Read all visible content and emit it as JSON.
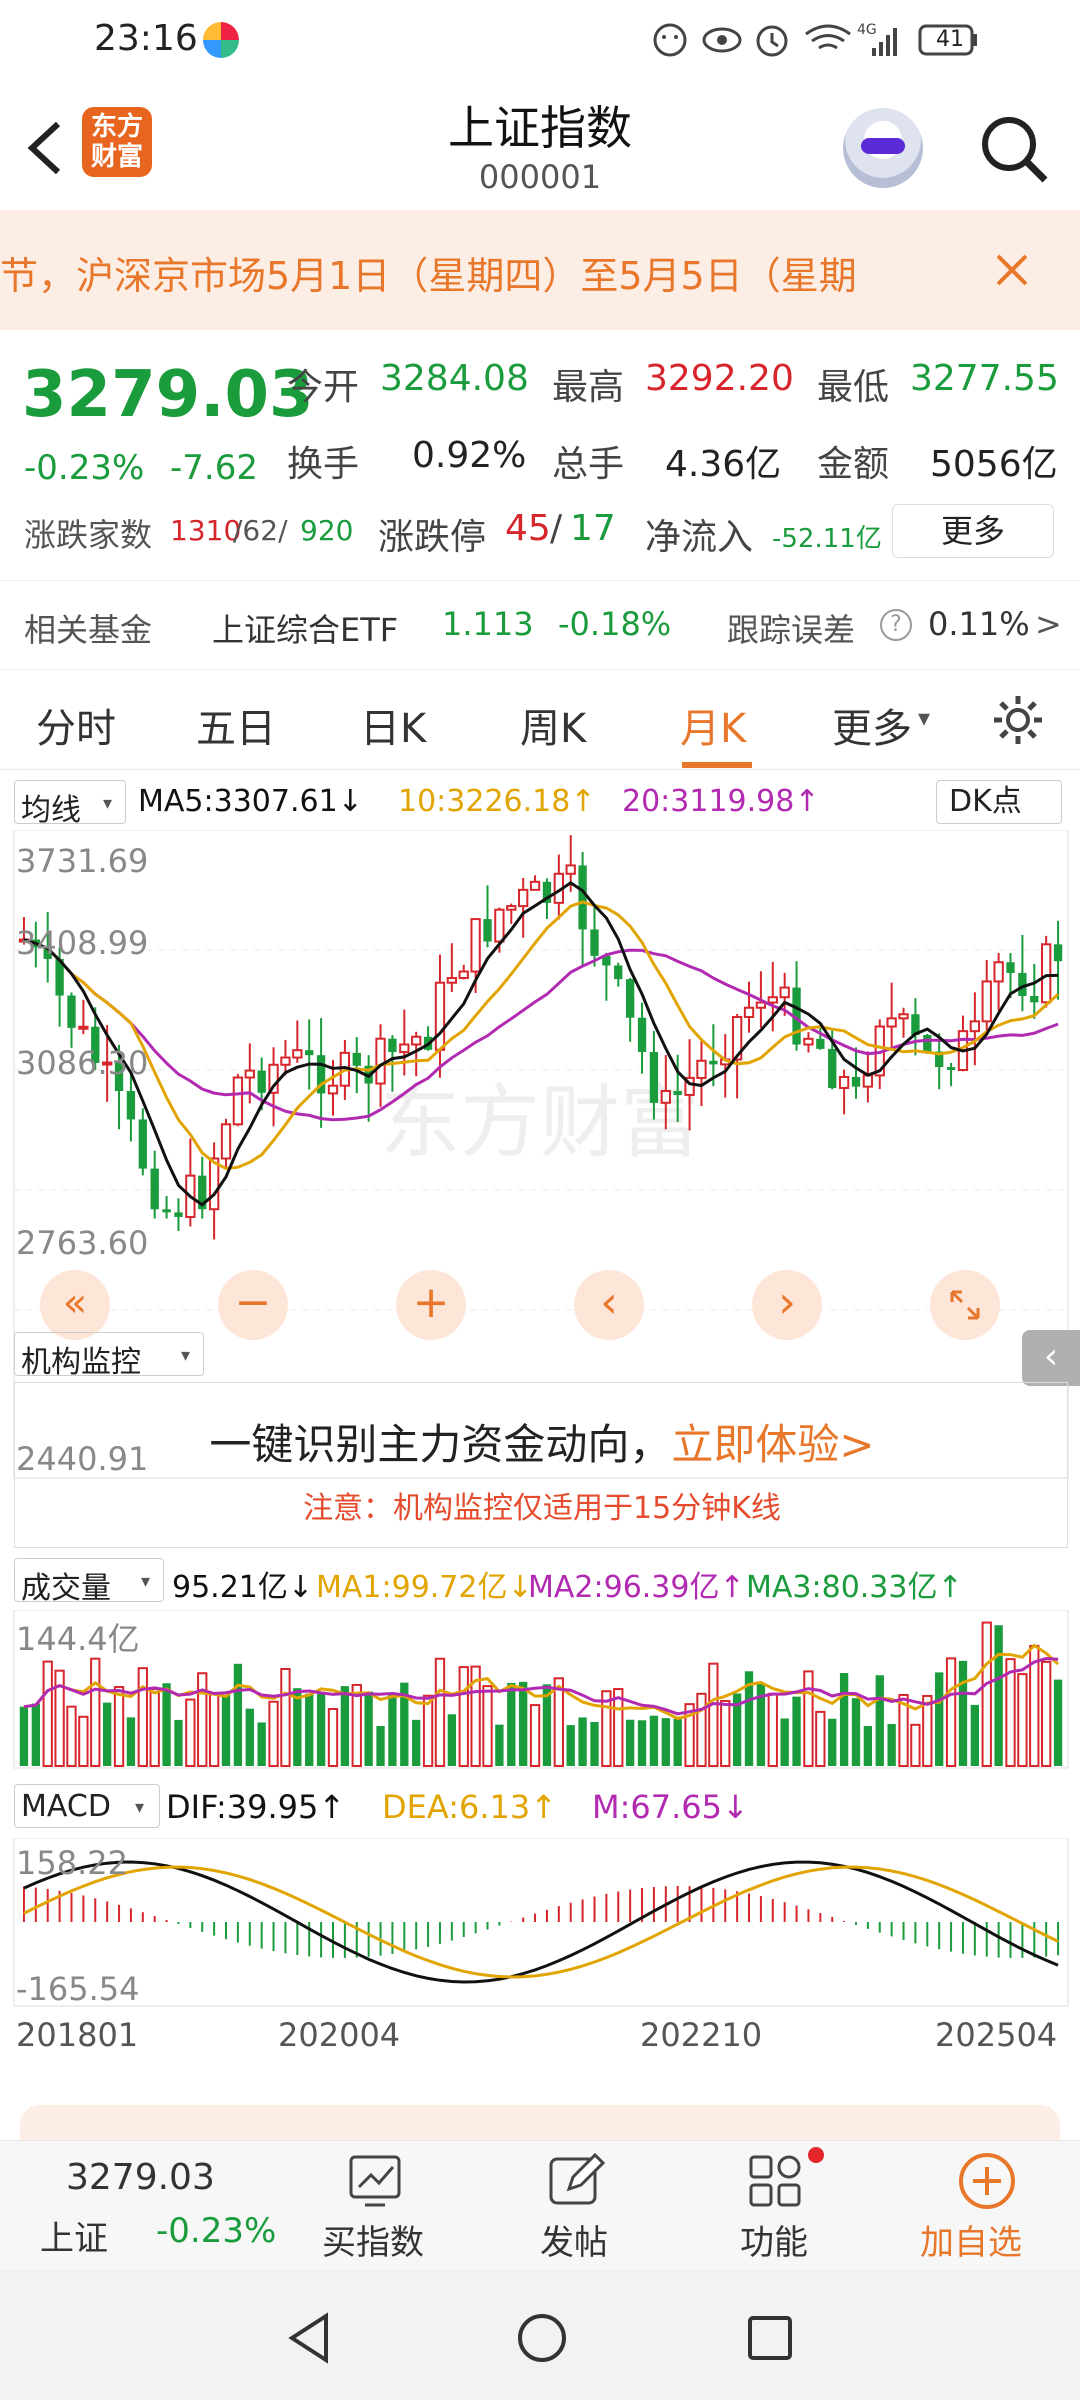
{
  "status_bar": {
    "time": "23:16",
    "network": "4G",
    "battery": "41",
    "icons": [
      "app-logo-icon",
      "face-icon",
      "eye-icon",
      "alarm-icon",
      "wifi-icon",
      "signal-icon",
      "battery-icon"
    ]
  },
  "header": {
    "logo_text": "东方\n财富",
    "title": "上证指数",
    "code": "000001",
    "icons": [
      "back-icon",
      "robot-avatar-icon",
      "search-icon"
    ]
  },
  "notice": {
    "text": "节，沪深京市场5月1日（星期四）至5月5日（星期",
    "close_icon": "close-icon"
  },
  "quote": {
    "price": "3279.03",
    "change_pct": "-0.23%",
    "change": "-7.62",
    "open_label": "今开",
    "open": "3284.08",
    "high_label": "最高",
    "high": "3292.20",
    "low_label": "最低",
    "low": "3277.55",
    "turnover_label": "换手",
    "turnover": "0.92%",
    "volume_label": "总手",
    "volume": "4.36亿",
    "amount_label": "金额",
    "amount": "5056亿",
    "breadth_label": "涨跌家数",
    "breadth_up": "1310",
    "breadth_flat": "/62/",
    "breadth_down": "920",
    "limit_label": "涨跌停",
    "limit_up": "45",
    "limit_sep": "/",
    "limit_down": "17",
    "inflow_label": "净流入",
    "inflow": "-52.11亿",
    "more_button": "更多"
  },
  "fund": {
    "label": "相关基金",
    "name": "上证综合ETF",
    "price": "1.113",
    "change": "-0.18%",
    "tracking_label": "跟踪误差",
    "tracking": "0.11%",
    "arrow": ">"
  },
  "tabs": {
    "items": [
      "分时",
      "五日",
      "日K",
      "周K",
      "月K",
      "更多"
    ],
    "active": "月K",
    "more_suffix": "▾",
    "settings_icon": "gear-icon"
  },
  "ma": {
    "selector": "均线",
    "ma5": "MA5:3307.61↓",
    "ma10": "10:3226.18↑",
    "ma20": "20:3119.98↑",
    "dk": "DK点"
  },
  "kline_axis": [
    "3731.69",
    "3408.99",
    "3086.30",
    "2763.60",
    "2440.91"
  ],
  "chart_controls": [
    "«",
    "−",
    "+",
    "‹",
    "›",
    "expand-icon"
  ],
  "watermark": "东方财富",
  "institution": {
    "selector": "机构监控",
    "headline": "一键识别主力资金动向，",
    "cta": "立即体验>",
    "note": "注意：机构监控仅适用于15分钟K线"
  },
  "volume": {
    "selector": "成交量",
    "value": "95.21亿↓",
    "ma1": "MA1:99.72亿↓",
    "ma2": "MA2:96.39亿↑",
    "ma3": "MA3:80.33亿↑",
    "axis_max": "144.4亿"
  },
  "macd": {
    "selector": "MACD",
    "dif": "DIF:39.95↑",
    "dea": "DEA:6.13↑",
    "m": "M:67.65↓",
    "axis_top": "158.22",
    "axis_bottom": "-165.54"
  },
  "dates": [
    "201801",
    "202004",
    "202210",
    "202504"
  ],
  "bottom_nav": {
    "price": "3279.03",
    "name": "上证",
    "change": "-0.23%",
    "items": [
      "买指数",
      "发帖",
      "功能",
      "加自选"
    ],
    "icons": [
      "chart-icon",
      "edit-icon",
      "apps-icon",
      "add-circle-icon"
    ]
  },
  "system_nav": [
    "back-triangle-icon",
    "home-circle-icon",
    "recents-square-icon"
  ],
  "colors": {
    "up": "#d6262c",
    "down": "#1a9b3c",
    "accent": "#e8772b",
    "ma5": "#111111",
    "ma10": "#e1a400",
    "ma20": "#b12ab1"
  }
}
